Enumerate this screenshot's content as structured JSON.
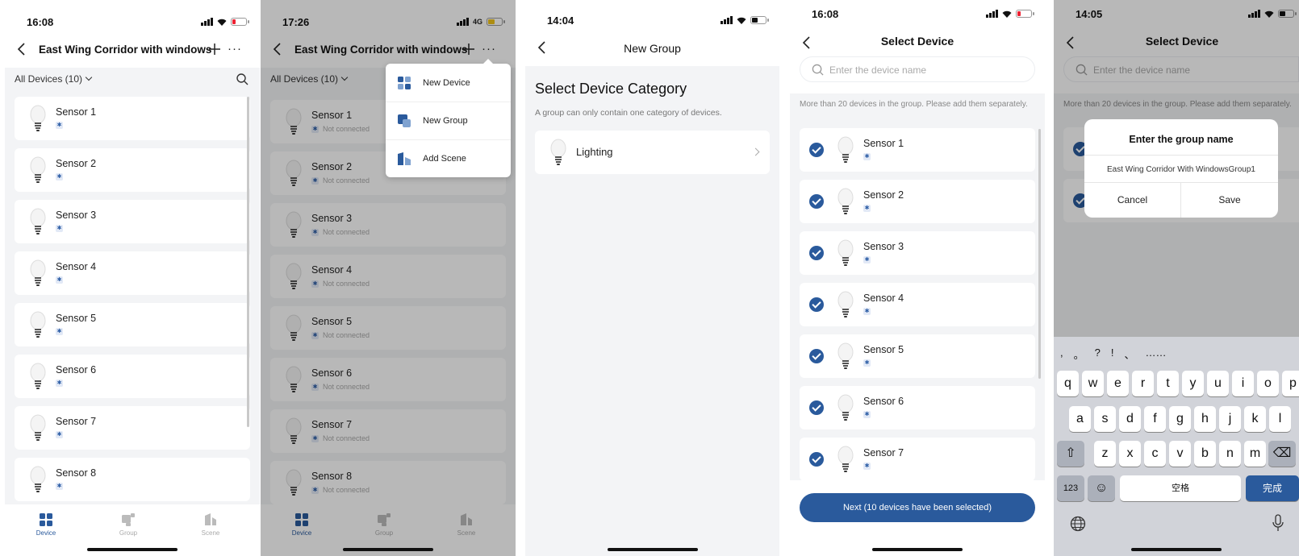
{
  "colors": {
    "accent": "#2a5a9c",
    "background": "#f3f4f6",
    "card": "#ffffff"
  },
  "screen1": {
    "time": "16:08",
    "title": "East Wing Corridor with windows",
    "filter": "All Devices (10)",
    "devices": [
      {
        "name": "Sensor 1"
      },
      {
        "name": "Sensor 2"
      },
      {
        "name": "Sensor 3"
      },
      {
        "name": "Sensor 4"
      },
      {
        "name": "Sensor 5"
      },
      {
        "name": "Sensor 6"
      },
      {
        "name": "Sensor 7"
      },
      {
        "name": "Sensor 8"
      }
    ],
    "tabs": [
      "Device",
      "Group",
      "Scene"
    ]
  },
  "screen2": {
    "time": "17:26",
    "network": "4G",
    "title": "East Wing Corridor with windows",
    "filter": "All Devices (10)",
    "devices": [
      {
        "name": "Sensor 1",
        "status": "Not connected"
      },
      {
        "name": "Sensor 2",
        "status": "Not connected"
      },
      {
        "name": "Sensor 3",
        "status": "Not connected"
      },
      {
        "name": "Sensor 4",
        "status": "Not connected"
      },
      {
        "name": "Sensor 5",
        "status": "Not connected"
      },
      {
        "name": "Sensor 6",
        "status": "Not connected"
      },
      {
        "name": "Sensor 7",
        "status": "Not connected"
      },
      {
        "name": "Sensor 8",
        "status": "Not connected"
      }
    ],
    "menu": [
      "New Device",
      "New Group",
      "Add Scene"
    ],
    "tabs": [
      "Device",
      "Group",
      "Scene"
    ]
  },
  "screen3": {
    "time": "14:04",
    "title": "New Group",
    "heading": "Select Device Category",
    "note": "A group can only contain one category of devices.",
    "category": "Lighting"
  },
  "screen4": {
    "time": "16:08",
    "title": "Select Device",
    "search_placeholder": "Enter the device name",
    "hint": "More than 20 devices in the group. Please add them separately.",
    "devices": [
      {
        "name": "Sensor 1"
      },
      {
        "name": "Sensor 2"
      },
      {
        "name": "Sensor 3"
      },
      {
        "name": "Sensor 4"
      },
      {
        "name": "Sensor 5"
      },
      {
        "name": "Sensor 6"
      },
      {
        "name": "Sensor 7"
      }
    ],
    "next_button": "Next (10 devices have been selected)"
  },
  "screen5": {
    "time": "14:05",
    "title": "Select Device",
    "search_placeholder": "Enter the device name",
    "hint": "More than 20 devices in the group. Please add them separately.",
    "dialog": {
      "title": "Enter the group name",
      "value": "East Wing Corridor With WindowsGroup1",
      "cancel": "Cancel",
      "save": "Save"
    },
    "keyboard": {
      "candidates": [
        ",",
        "。",
        "?",
        "!",
        "、",
        "……"
      ],
      "row1": [
        "q",
        "w",
        "e",
        "r",
        "t",
        "y",
        "u",
        "i",
        "o",
        "p"
      ],
      "row2": [
        "a",
        "s",
        "d",
        "f",
        "g",
        "h",
        "j",
        "k",
        "l"
      ],
      "row3": [
        "z",
        "x",
        "c",
        "v",
        "b",
        "n",
        "m"
      ],
      "num_key": "123",
      "space_key": "空格",
      "done_key": "完成"
    }
  }
}
